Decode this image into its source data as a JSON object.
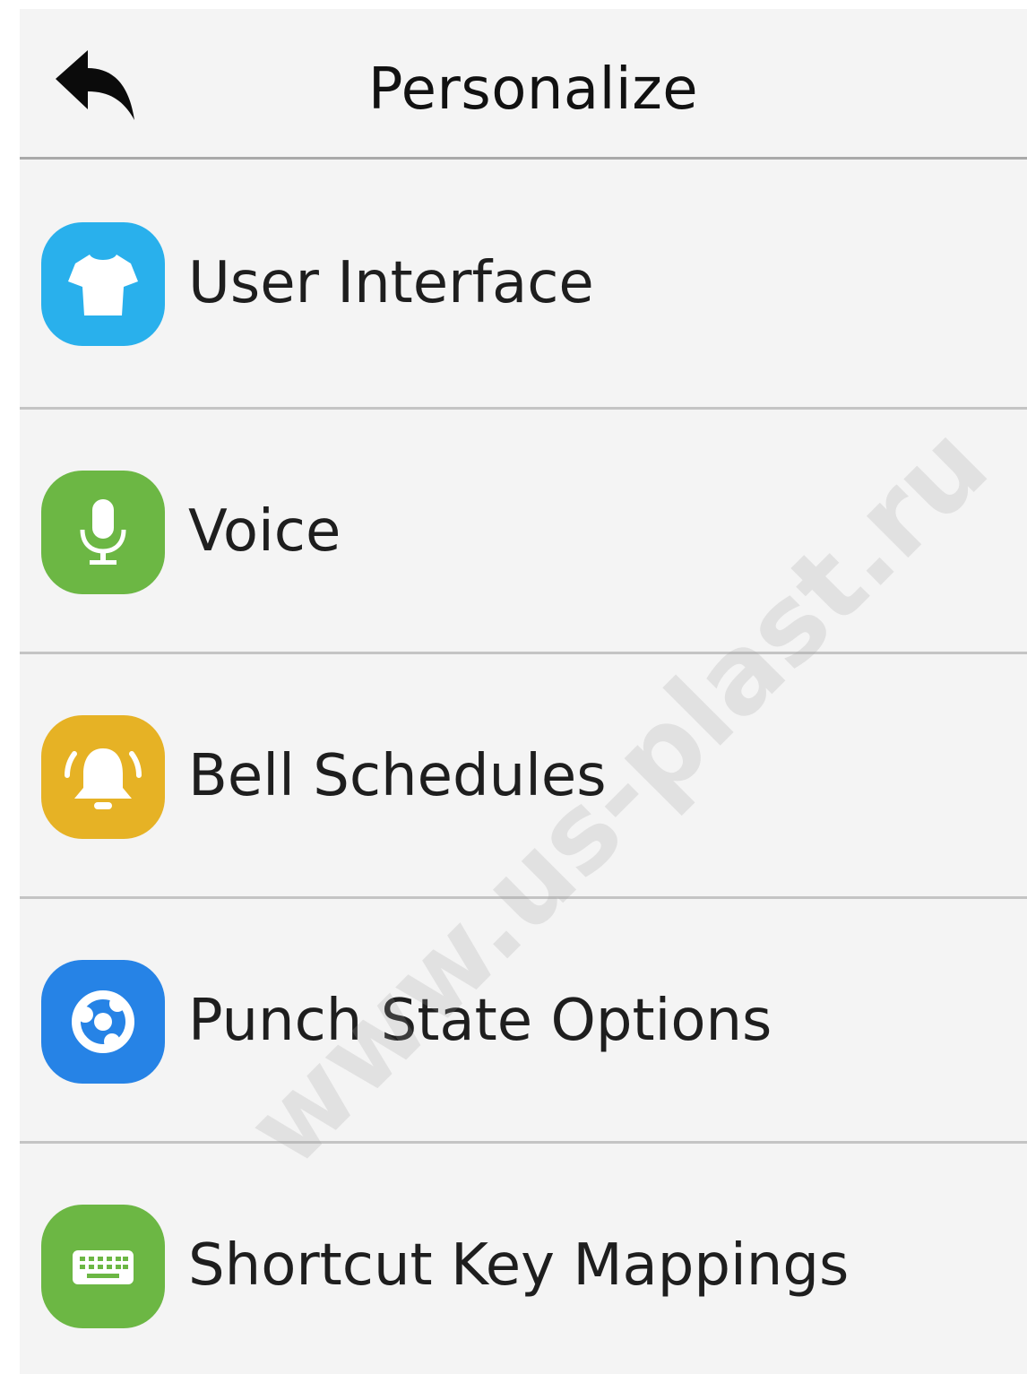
{
  "header": {
    "title": "Personalize",
    "back_icon": "back-arrow-icon"
  },
  "menu": {
    "items": [
      {
        "label": "User Interface",
        "icon": "tshirt-icon",
        "color": "#29b0ec"
      },
      {
        "label": "Voice",
        "icon": "microphone-icon",
        "color": "#6cb744"
      },
      {
        "label": "Bell Schedules",
        "icon": "bell-icon",
        "color": "#e6b225"
      },
      {
        "label": "Punch State Options",
        "icon": "punch-state-icon",
        "color": "#2683e6"
      },
      {
        "label": "Shortcut Key Mappings",
        "icon": "keyboard-icon",
        "color": "#6cb744"
      }
    ]
  },
  "watermark": "www.us-plast.ru"
}
